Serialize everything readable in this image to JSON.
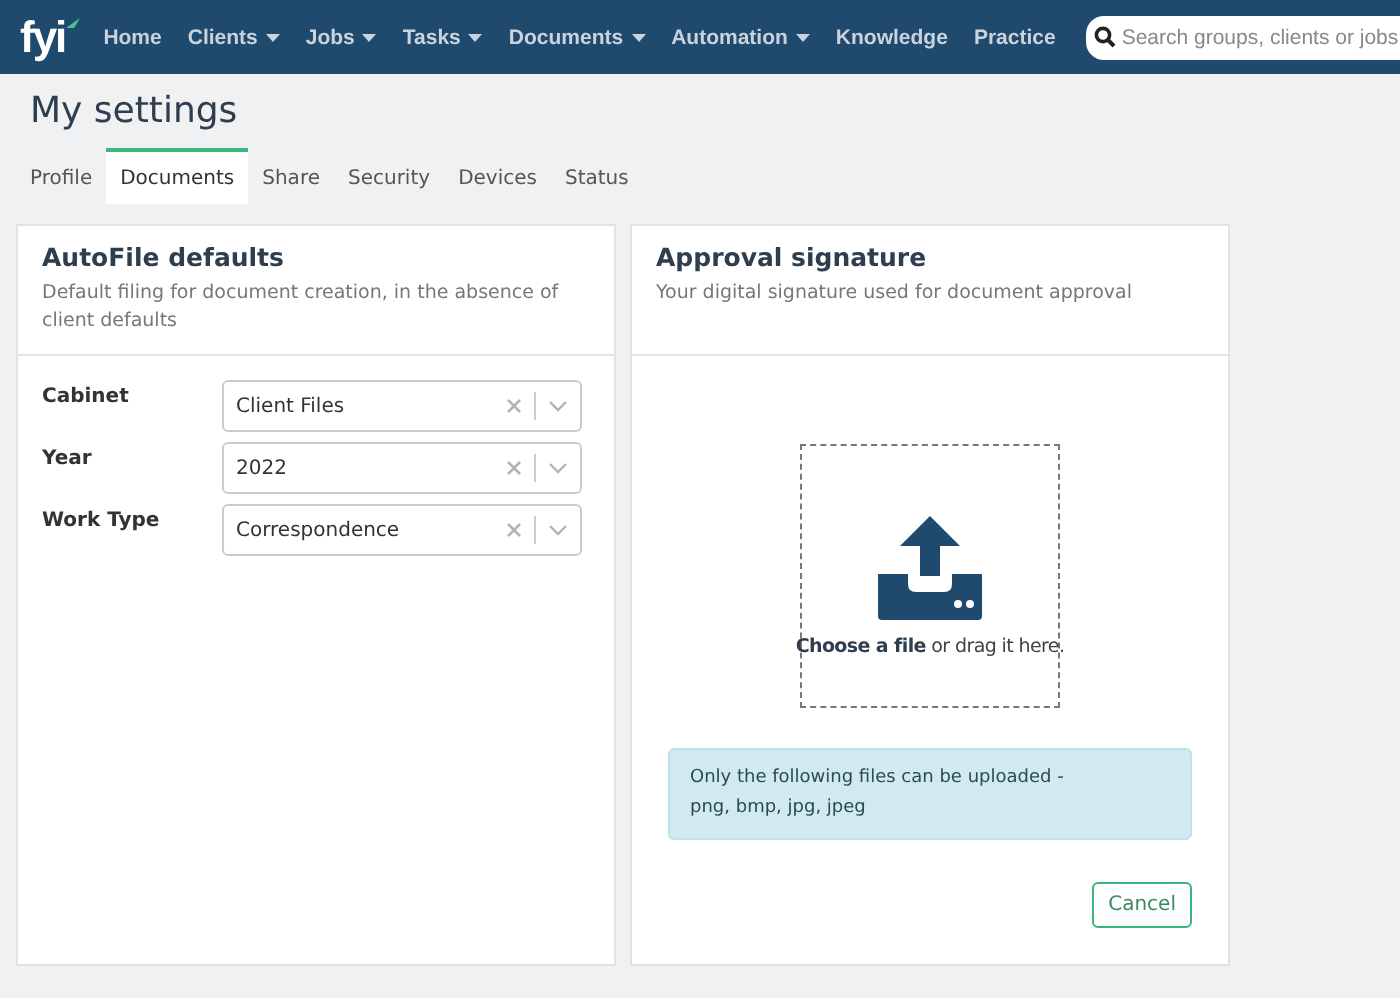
{
  "nav": {
    "logo": "fyi",
    "items": [
      {
        "label": "Home",
        "dropdown": false
      },
      {
        "label": "Clients",
        "dropdown": true
      },
      {
        "label": "Jobs",
        "dropdown": true
      },
      {
        "label": "Tasks",
        "dropdown": true
      },
      {
        "label": "Documents",
        "dropdown": true
      },
      {
        "label": "Automation",
        "dropdown": true
      },
      {
        "label": "Knowledge",
        "dropdown": false
      },
      {
        "label": "Practice",
        "dropdown": false
      }
    ],
    "search": {
      "placeholder": "Search groups, clients or jobs"
    }
  },
  "page_title": "My settings",
  "tabs": [
    {
      "label": "Profile",
      "selected": false
    },
    {
      "label": "Documents",
      "selected": true
    },
    {
      "label": "Share",
      "selected": false
    },
    {
      "label": "Security",
      "selected": false
    },
    {
      "label": "Devices",
      "selected": false
    },
    {
      "label": "Status",
      "selected": false
    }
  ],
  "autofile": {
    "title": "AutoFile defaults",
    "description": "Default filing for document creation, in the absence of client defaults",
    "fields": [
      {
        "label": "Cabinet",
        "value": "Client Files"
      },
      {
        "label": "Year",
        "value": "2022"
      },
      {
        "label": "Work Type",
        "value": "Correspondence"
      }
    ]
  },
  "signature": {
    "title": "Approval signature",
    "description": "Your digital signature used for document approval",
    "dropzone": "**Choose a file** or drag it here.",
    "notice": [
      "Only the following files can be uploaded -",
      "png, bmp, jpg, jpeg"
    ],
    "buttons": [
      "Cancel"
    ]
  }
}
